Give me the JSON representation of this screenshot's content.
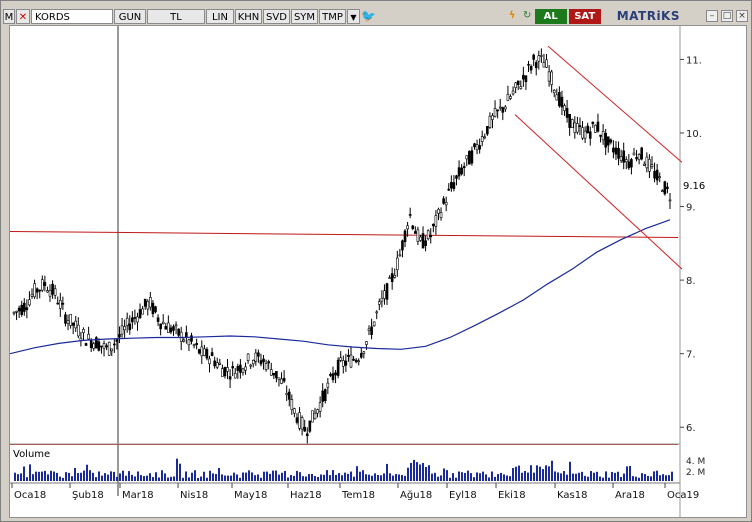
{
  "toolbar": {
    "m_button": "M",
    "symbol": "KORDS",
    "period": "GUN",
    "currency": "TL",
    "scale": "LIN",
    "khn": "KHN",
    "svd": "SVD",
    "sym": "SYM",
    "tmp": "TMP",
    "buy": "AL",
    "sell": "SAT",
    "brand": "MATRiKS",
    "icons": [
      "dropdown-icon",
      "twitter-icon",
      "refresh-icon",
      "settings-icon",
      "minimize-icon",
      "maximize-icon",
      "close-icon"
    ]
  },
  "volume_panel": {
    "label": "Volume",
    "ticks": [
      "4. M",
      "2. M"
    ]
  },
  "price_axis": {
    "last_price": "9.16"
  },
  "chart_data": {
    "type": "candlestick",
    "symbol": "KORDS",
    "y_ticks": [
      6,
      7,
      8,
      9,
      10,
      11
    ],
    "y_tick_labels": [
      "6.",
      "7.",
      "8.",
      "9.",
      "10.",
      "11."
    ],
    "ylim": [
      5.84,
      11.4
    ],
    "x_labels": [
      "Oca18",
      "Şub18",
      "Mar18",
      "Nis18",
      "May18",
      "Haz18",
      "Tem18",
      "Ağu18",
      "Eyl18",
      "Eki18",
      "Kas18",
      "Ara18",
      "Oca19"
    ],
    "last_price": 9.16,
    "close_series_approx": [
      7.55,
      7.65,
      7.85,
      7.95,
      7.8,
      7.5,
      7.35,
      7.2,
      7.15,
      7.05,
      7.2,
      7.4,
      7.55,
      7.7,
      7.45,
      7.35,
      7.25,
      7.15,
      7.0,
      6.95,
      6.8,
      6.75,
      6.85,
      6.95,
      6.9,
      6.75,
      6.55,
      6.2,
      5.95,
      6.2,
      6.5,
      6.8,
      6.9,
      6.95,
      7.2,
      7.6,
      7.9,
      8.3,
      8.9,
      8.5,
      8.6,
      8.95,
      9.25,
      9.5,
      9.7,
      9.95,
      10.2,
      10.35,
      10.55,
      10.75,
      11.0,
      10.95,
      10.6,
      10.25,
      10.05,
      10.0,
      10.1,
      9.85,
      9.75,
      9.6,
      9.75,
      9.55,
      9.35,
      9.16
    ],
    "moving_average_approx": [
      7.0,
      7.08,
      7.14,
      7.18,
      7.2,
      7.21,
      7.22,
      7.22,
      7.23,
      7.24,
      7.23,
      7.2,
      7.17,
      7.12,
      7.09,
      7.07,
      7.06,
      7.1,
      7.22,
      7.38,
      7.55,
      7.73,
      7.95,
      8.15,
      8.38,
      8.55,
      8.7,
      8.82
    ],
    "horizontal_lines": [
      8.62,
      5.82
    ],
    "channel_upper": [
      [
        0,
        11.18
      ],
      [
        1,
        9.6
      ]
    ],
    "channel_lower": [
      [
        0,
        10.25
      ],
      [
        1,
        8.15
      ]
    ],
    "volume_ticks": [
      "4. M",
      "2. M"
    ]
  }
}
